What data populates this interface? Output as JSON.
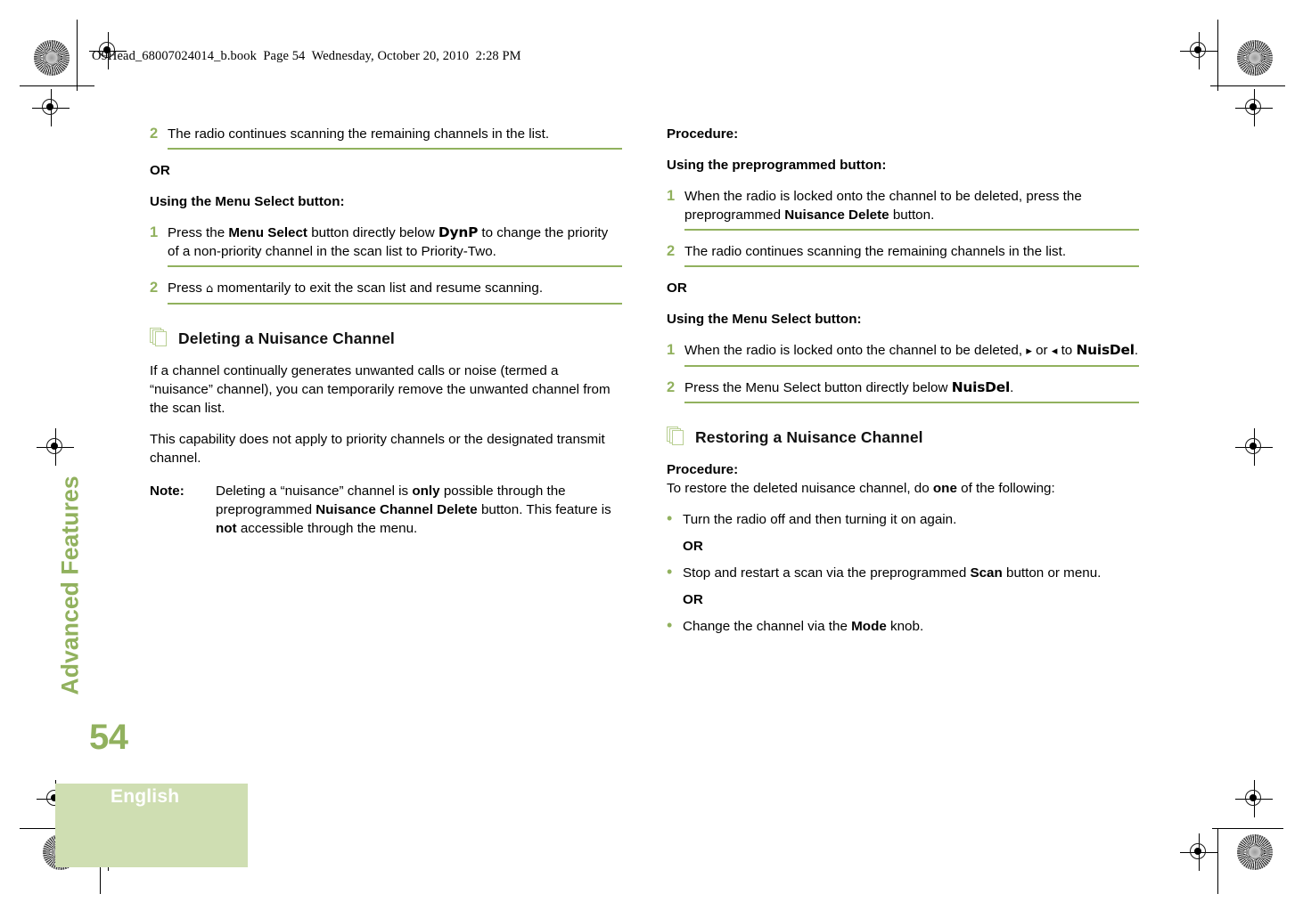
{
  "document": {
    "header_line": "O9Head_68007024014_b.book  Page 54  Wednesday, October 20, 2010  2:28 PM",
    "chapter_tab": "Advanced Features",
    "page_number": "54",
    "language": "English",
    "accent_green": "#91b15e",
    "band_green": "#cfdeb2",
    "icon_outline_green": "#b9cf93"
  },
  "left_column": {
    "step_a2_num": "2",
    "step_a2_text": "The radio continues scanning the remaining channels in the list.",
    "or_1": "OR",
    "subhead_menu_select": "Using the Menu Select button:",
    "step_b1_num": "1",
    "step_b1_pre": "Press the ",
    "step_b1_bold1": "Menu Select",
    "step_b1_mid": " button directly below ",
    "step_b1_ui": "DynP",
    "step_b1_post": " to change the priority of a non-priority channel in the scan list to Priority-Two.",
    "step_b2_num": "2",
    "step_b2_pre": "Press ",
    "step_b2_glyph": "⌂",
    "step_b2_post": " momentarily to exit the scan list and resume scanning.",
    "section_title": "Deleting a Nuisance Channel",
    "para_1": "If a channel continually generates unwanted calls or noise (termed a “nuisance” channel), you can temporarily remove the unwanted channel from the scan list.",
    "para_2": "This capability does not apply to priority channels or the designated transmit channel.",
    "note_label": "Note:",
    "note_pre": "Deleting a “nuisance” channel is ",
    "note_bold1": "only",
    "note_mid1": " possible through the preprogrammed ",
    "note_bold2": "Nuisance Channel Delete",
    "note_mid2": " button. This feature is ",
    "note_bold3": "not",
    "note_post": " accessible through the menu."
  },
  "right_column": {
    "procedure_label": "Procedure:",
    "subhead_preprogrammed": "Using the preprogrammed button:",
    "step_c1_num": "1",
    "step_c1_pre": "When the radio is locked onto the channel to be deleted, press the preprogrammed ",
    "step_c1_bold": "Nuisance Delete",
    "step_c1_post": " button.",
    "step_c2_num": "2",
    "step_c2_text": "The radio continues scanning the remaining channels in the list.",
    "or_1": "OR",
    "subhead_menu_select": "Using the Menu Select button:",
    "step_d1_num": "1",
    "step_d1_pre": "When the radio is locked onto the channel to be deleted, ",
    "step_d1_glyph_right": "▸",
    "step_d1_mid": " or ",
    "step_d1_glyph_left": "◂",
    "step_d1_mid2": " to ",
    "step_d1_ui": "NuisDel",
    "step_d1_post": ".",
    "step_d2_num": "2",
    "step_d2_pre": "Press the Menu Select button directly below ",
    "step_d2_ui": "NuisDel",
    "step_d2_post": ".",
    "section_title": "Restoring a Nuisance Channel",
    "procedure_label_2": "Procedure:",
    "restore_intro_pre": "To restore the deleted nuisance channel, do ",
    "restore_intro_bold": "one",
    "restore_intro_post": " of the following:",
    "bullet_1": "Turn the radio off and then turning it on again.",
    "sub_or_1": "OR",
    "bullet_2_pre": "Stop and restart a scan via the preprogrammed ",
    "bullet_2_bold": "Scan",
    "bullet_2_post": " button or menu.",
    "sub_or_2": "OR",
    "bullet_3_pre": "Change the channel via the ",
    "bullet_3_bold": "Mode",
    "bullet_3_post": " knob."
  }
}
